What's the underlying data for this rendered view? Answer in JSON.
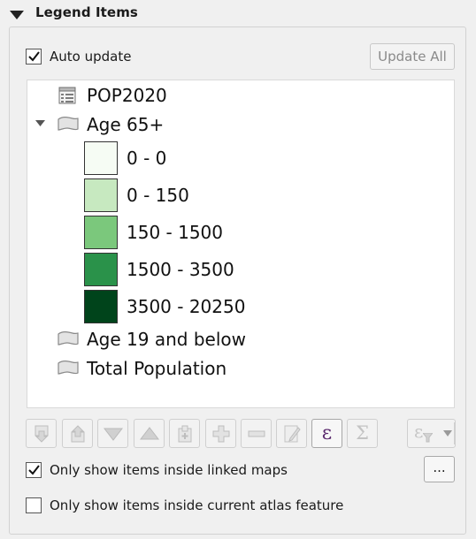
{
  "section": {
    "title": "Legend Items",
    "icon": "collapse-arrow-down-icon"
  },
  "auto_update": {
    "label": "Auto update",
    "checked": true
  },
  "update_all_button": {
    "label": "Update All",
    "enabled": false
  },
  "tree": {
    "items": [
      {
        "label": "POP2020",
        "icon": "table-icon",
        "kind": "layer"
      },
      {
        "label": "Age 65+",
        "icon": "group-icon",
        "kind": "group",
        "expanded": true
      },
      {
        "label": "Age 19 and below",
        "icon": "group-icon",
        "kind": "group",
        "expanded": false
      },
      {
        "label": "Total Population",
        "icon": "group-icon",
        "kind": "group",
        "expanded": false
      }
    ],
    "classes": [
      {
        "label": "0 - 0",
        "color": "#f6fcf4"
      },
      {
        "label": "0 - 150",
        "color": "#c7e9c0"
      },
      {
        "label": "150 - 1500",
        "color": "#7bc87c"
      },
      {
        "label": "1500 - 3500",
        "color": "#2a924a"
      },
      {
        "label": "3500 - 20250",
        "color": "#00441b"
      }
    ]
  },
  "toolbar": {
    "buttons": [
      {
        "name": "move-down-layer-button",
        "icon": "move-down-icon",
        "enabled": false
      },
      {
        "name": "move-up-layer-button",
        "icon": "move-up-icon",
        "enabled": false
      },
      {
        "name": "move-down-button",
        "icon": "triangle-down-icon",
        "enabled": false
      },
      {
        "name": "move-up-button",
        "icon": "triangle-up-icon",
        "enabled": false
      },
      {
        "name": "add-group-button",
        "icon": "add-group-icon",
        "enabled": false
      },
      {
        "name": "add-item-button",
        "icon": "plus-icon",
        "enabled": false
      },
      {
        "name": "remove-item-button",
        "icon": "minus-icon",
        "enabled": false
      },
      {
        "name": "edit-item-button",
        "icon": "pencil-icon",
        "enabled": false
      },
      {
        "name": "expression-button",
        "icon": "epsilon-icon",
        "enabled": true
      },
      {
        "name": "count-features-button",
        "icon": "sigma-icon",
        "enabled": false
      },
      {
        "name": "filter-expression-button",
        "icon": "epsilon-filter-icon",
        "enabled": false
      }
    ],
    "expression_glyph": "ε",
    "sigma_glyph": "Σ"
  },
  "filter_by_map": {
    "label": "Only show items inside linked maps",
    "checked": true
  },
  "linked_maps_button": {
    "label": "..."
  },
  "filter_by_atlas": {
    "label": "Only show items inside current atlas feature",
    "checked": false
  }
}
